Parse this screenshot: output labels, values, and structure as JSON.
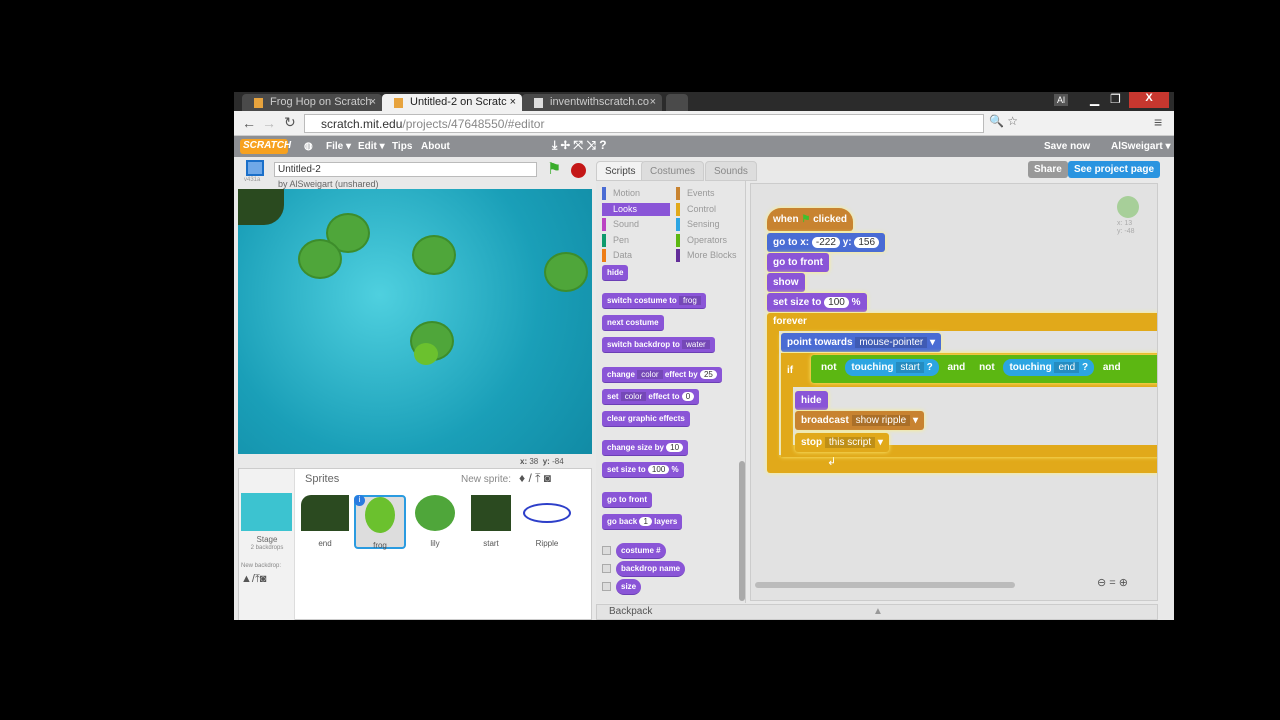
{
  "browser": {
    "tabs": [
      {
        "label": "Frog Hop on Scratch",
        "active": false
      },
      {
        "label": "Untitled-2 on Scratc",
        "active": true
      },
      {
        "label": "inventwithscratch.co",
        "active": false
      }
    ],
    "url_host": "scratch.mit.edu",
    "url_path": "/projects/47648550/#editor",
    "profile": "Al"
  },
  "menubar": {
    "logo": "SCRATCH",
    "items": [
      "File ▾",
      "Edit ▾",
      "Tips",
      "About"
    ],
    "save": "Save now",
    "user": "AlSweigart ▾"
  },
  "project": {
    "title": "Untitled-2",
    "byline": "by AlSweigart (unshared)",
    "version": "v431a"
  },
  "stage": {
    "mouse_x_label": "x:",
    "mouse_x": "38",
    "mouse_y_label": "y:",
    "mouse_y": "-84"
  },
  "sprites": {
    "header": "Sprites",
    "new_sprite": "New sprite:",
    "stage_label": "Stage",
    "stage_sub": "2 backdrops",
    "new_backdrop": "New backdrop:",
    "items": [
      {
        "name": "end",
        "selected": false
      },
      {
        "name": "frog",
        "selected": true
      },
      {
        "name": "lily",
        "selected": false
      },
      {
        "name": "start",
        "selected": false
      },
      {
        "name": "Ripple",
        "selected": false
      }
    ]
  },
  "tabs": [
    "Scripts",
    "Costumes",
    "Sounds"
  ],
  "share": "Share",
  "see_project": "See project page",
  "categories": [
    {
      "name": "Motion",
      "color": "#4a6cd4"
    },
    {
      "name": "Looks",
      "color": "#8a55d7"
    },
    {
      "name": "Sound",
      "color": "#bb42c3"
    },
    {
      "name": "Pen",
      "color": "#0e9a6c"
    },
    {
      "name": "Data",
      "color": "#ee7d16"
    },
    {
      "name": "Events",
      "color": "#c88330"
    },
    {
      "name": "Control",
      "color": "#e1a91a"
    },
    {
      "name": "Sensing",
      "color": "#2ca5e2"
    },
    {
      "name": "Operators",
      "color": "#5cb712"
    },
    {
      "name": "More Blocks",
      "color": "#632d99"
    }
  ],
  "palette": {
    "hide": "hide",
    "switch_costume": "switch costume to",
    "costume": "frog",
    "next_costume": "next costume",
    "switch_backdrop": "switch backdrop to",
    "backdrop": "water",
    "change": "change",
    "color": "color",
    "effect_by": "effect by",
    "by_val": "25",
    "set": "set",
    "effect_to": "effect to",
    "to_val": "0",
    "clear": "clear graphic effects",
    "change_size": "change size by",
    "size_by": "10",
    "set_size": "set size to",
    "size_to": "100",
    "pct": "%",
    "go_front": "go to front",
    "go_back": "go back",
    "layers_val": "1",
    "layers": "layers",
    "rep_costume": "costume #",
    "rep_backdrop": "backdrop name",
    "rep_size": "size"
  },
  "script": {
    "when": "when",
    "clicked": "clicked",
    "goto": "go to x:",
    "x": "-222",
    "y_label": "y:",
    "y": "156",
    "front": "go to front",
    "show": "show",
    "setsize": "set size to",
    "size": "100",
    "pct": "%",
    "forever": "forever",
    "point": "point towards",
    "target": "mouse-pointer",
    "if": "if",
    "not": "not",
    "touching": "touching",
    "start": "start",
    "q": "?",
    "and": "and",
    "end": "end",
    "hide": "hide",
    "broadcast": "broadcast",
    "msg": "show ripple",
    "stop": "stop",
    "stop_opt": "this script"
  },
  "sprite_info": {
    "x": "x: 13",
    "y": "y: -48"
  },
  "backpack": "Backpack"
}
